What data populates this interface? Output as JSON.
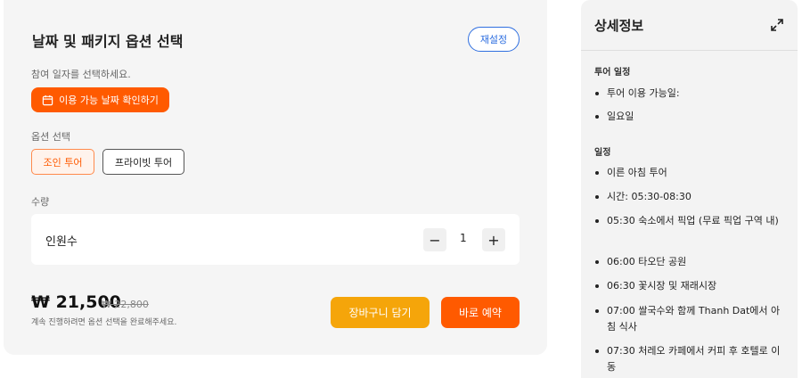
{
  "options_card": {
    "title": "날짜 및 패키지 옵션 선택",
    "reset_label": "재설정",
    "date_prompt": "참여 일자를 선택하세요.",
    "date_button_label": "이용 가능 날짜 확인하기",
    "option_label": "옵션 선택",
    "options": [
      "조인 투어",
      "프라이빗 투어"
    ],
    "selected_option": "조인 투어",
    "quantity_label": "수량",
    "quantity_item_label": "인원수",
    "quantity_value": "1",
    "minus": "−",
    "plus": "+",
    "price": "₩ 21,500",
    "old_price": "₩ 22,800",
    "hint": "계속 진행하려면 옵션 선택을 완료해주세요.",
    "cart_button": "장바구니 담기",
    "book_button": "바로 예약",
    "accent_color": "#ff5a00",
    "cart_color": "#f5a50a"
  },
  "details_panel": {
    "title": "상세정보",
    "expand_icon": "expand-icon",
    "tour_schedule_heading": "투어 일정",
    "tour_schedule_items": [
      "투어 이용 가능일:",
      "일요일"
    ],
    "itinerary_heading": "일정",
    "itinerary_items": [
      "이른 아침 투어",
      "시간: 05:30-08:30",
      "05:30 숙소에서 픽업 (무료 픽업 구역 내)",
      "06:00 타오단 공원",
      "06:30 꽃시장 및 재래시장",
      "07:00 쌀국수와 함께 Thanh Dat에서 아침 식사",
      "07:30 처레오 카페에서 커피 후 호텔로 이동"
    ]
  }
}
